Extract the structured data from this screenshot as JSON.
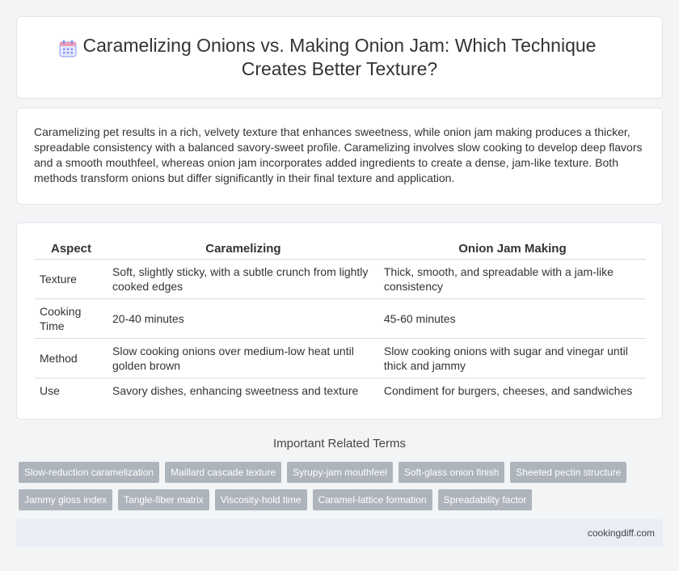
{
  "header": {
    "title": "Caramelizing Onions vs. Making Onion Jam: Which Technique Creates Better Texture?",
    "icon": "calendar-icon"
  },
  "intro": {
    "text": "Caramelizing pet results in a rich, velvety texture that enhances sweetness, while onion jam making produces a thicker, spreadable consistency with a balanced savory-sweet profile. Caramelizing involves slow cooking to develop deep flavors and a smooth mouthfeel, whereas onion jam incorporates added ingredients to create a dense, jam-like texture. Both methods transform onions but differ significantly in their final texture and application."
  },
  "table": {
    "headers": [
      "Aspect",
      "Caramelizing",
      "Onion Jam Making"
    ],
    "rows": [
      [
        "Texture",
        "Soft, slightly sticky, with a subtle crunch from lightly cooked edges",
        "Thick, smooth, and spreadable with a jam-like consistency"
      ],
      [
        "Cooking Time",
        "20-40 minutes",
        "45-60 minutes"
      ],
      [
        "Method",
        "Slow cooking onions over medium-low heat until golden brown",
        "Slow cooking onions with sugar and vinegar until thick and jammy"
      ],
      [
        "Use",
        "Savory dishes, enhancing sweetness and texture",
        "Condiment for burgers, cheeses, and sandwiches"
      ]
    ]
  },
  "related": {
    "title": "Important Related Terms",
    "tags": [
      "Slow-reduction caramelization",
      "Maillard cascade texture",
      "Syrupy-jam mouthfeel",
      "Soft-glass onion finish",
      "Sheeted pectin structure",
      "Jammy gloss index",
      "Tangle-fiber matrix",
      "Viscosity-hold time",
      "Caramel-lattice formation",
      "Spreadability factor"
    ]
  },
  "footer": {
    "site": "cookingdiff.com"
  },
  "colors": {
    "tag_bg": "#aeb4bb",
    "footer_bg": "#e9edf5",
    "icon_accent": "#7b8cf0"
  }
}
